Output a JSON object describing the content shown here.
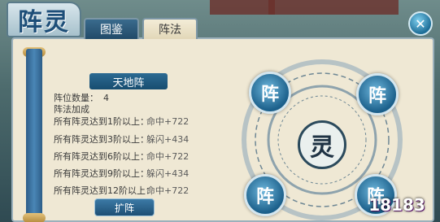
{
  "header": {
    "title": "阵灵",
    "tabs": [
      {
        "label": "图鉴"
      },
      {
        "label": "阵法"
      }
    ],
    "close_icon": "x-close-icon"
  },
  "formation": {
    "name": "天地阵",
    "count_label": "阵位数量：",
    "count_value": "4",
    "bonus_label": "阵法加成",
    "bonuses": [
      {
        "condition": "所有阵灵达到1阶以上：",
        "effect": "命中+722"
      },
      {
        "condition": "所有阵灵达到3阶以上：",
        "effect": "躲闪+434"
      },
      {
        "condition": "所有阵灵达到6阶以上：",
        "effect": "命中+722"
      },
      {
        "condition": "所有阵灵达到9阶以上：",
        "effect": "躲闪+434"
      },
      {
        "condition": "所有阵灵达到12阶以上：",
        "effect": "命中+722"
      }
    ],
    "expand_button": "扩阵"
  },
  "circle": {
    "slot_glyph": "阵",
    "center_glyph": "灵"
  },
  "watermark": "18183"
}
